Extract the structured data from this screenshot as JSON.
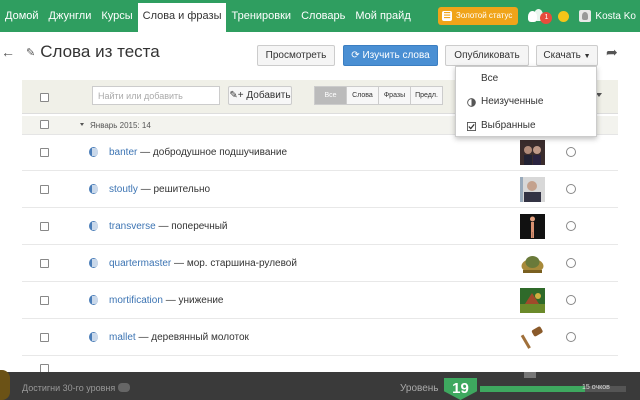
{
  "nav": {
    "items": [
      "Домой",
      "Джунгли",
      "Курсы",
      "Слова и фразы",
      "Тренировки",
      "Словарь",
      "Мой прайд"
    ],
    "gold_status": "Золотой статус",
    "notification_count": "1",
    "username": "Kosta Ko"
  },
  "header": {
    "title": "Слова из теста",
    "view_label": "Просмотреть",
    "learn_label": "Изучить слова",
    "publish_label": "Опубликовать",
    "download_label": "Скачать"
  },
  "toolbar": {
    "search_placeholder": "Найти или добавить",
    "add_label": "Добавить",
    "filters": [
      "Все",
      "Слова",
      "Фразы",
      "Предл."
    ]
  },
  "group": {
    "label": "Январь 2015: 14"
  },
  "rows": [
    {
      "word": "banter",
      "translation": "добродушное подшучивание",
      "thumb": "two-faces"
    },
    {
      "word": "stoutly",
      "translation": "решительно",
      "thumb": "man-portrait"
    },
    {
      "word": "transverse",
      "translation": "поперечный",
      "thumb": "human-figure"
    },
    {
      "word": "quartermaster",
      "translation": "мор. старшина-рулевой",
      "thumb": "helmet"
    },
    {
      "word": "mortification",
      "translation": "унижение",
      "thumb": "game-scene"
    },
    {
      "word": "mallet",
      "translation": "деревянный молоток",
      "thumb": "mallet"
    }
  ],
  "dropdown": {
    "items": [
      "Все",
      "Неизученные",
      "Выбранные"
    ]
  },
  "bottom": {
    "achievement": "Достигни 30-го уровня",
    "level_label": "Уровень",
    "level": "19",
    "score": "15 очков",
    "progress": 0.72
  },
  "colors": {
    "nav_green": "#2f9e60",
    "accent_blue": "#4a8fd3",
    "gold": "#f0a419",
    "link_blue": "#3c74b3"
  }
}
